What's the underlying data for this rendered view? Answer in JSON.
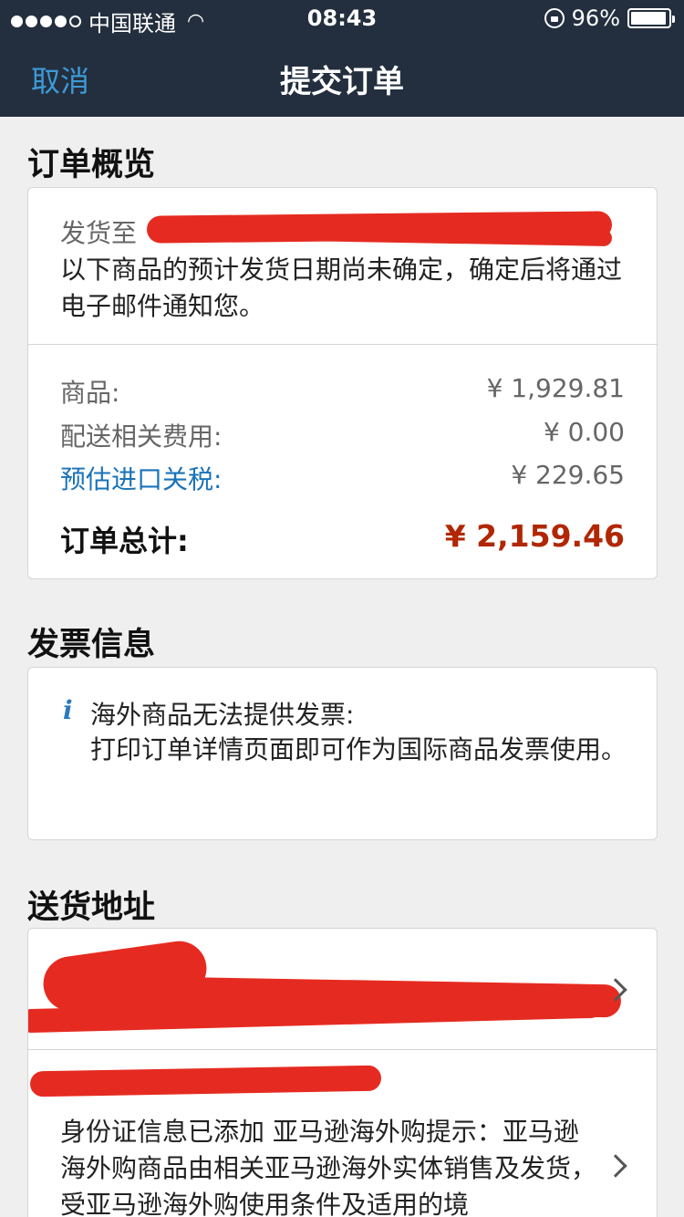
{
  "status_bar": {
    "carrier": "中国联通",
    "time": "08:43",
    "battery": "96%",
    "battery_level": 0.96
  },
  "nav": {
    "cancel_label": "取消",
    "title": "提交订单"
  },
  "order_summary": {
    "section_title": "订单概览",
    "ship_to_label": "发货至",
    "ship_note": "以下商品的预计发货日期尚未确定，确定后将通过电子邮件通知您。",
    "rows": [
      {
        "label": "商品:",
        "value": "¥ 1,929.81"
      },
      {
        "label": "配送相关费用:",
        "value": "¥ 0.00"
      },
      {
        "label": "预估进口关税:",
        "value": "¥ 229.65"
      }
    ],
    "total_label": "订单总计:",
    "total_value": "¥ 2,159.46"
  },
  "invoice": {
    "section_title": "发票信息",
    "info_icon": "i",
    "title": "海外商品无法提供发票:",
    "body": "打印订单详情页面即可作为国际商品发票使用。"
  },
  "shipping": {
    "section_title": "送货地址",
    "id_note": "身份证信息已添加 亚马逊海外购提示：亚马逊海外购商品由相关亚马逊海外实体销售及发货，受亚马逊海外购使用条件及适用的境"
  },
  "colors": {
    "header_bg": "#232f3e",
    "link": "#1a73b8",
    "total_price": "#b12704",
    "redaction": "#e52b21"
  }
}
